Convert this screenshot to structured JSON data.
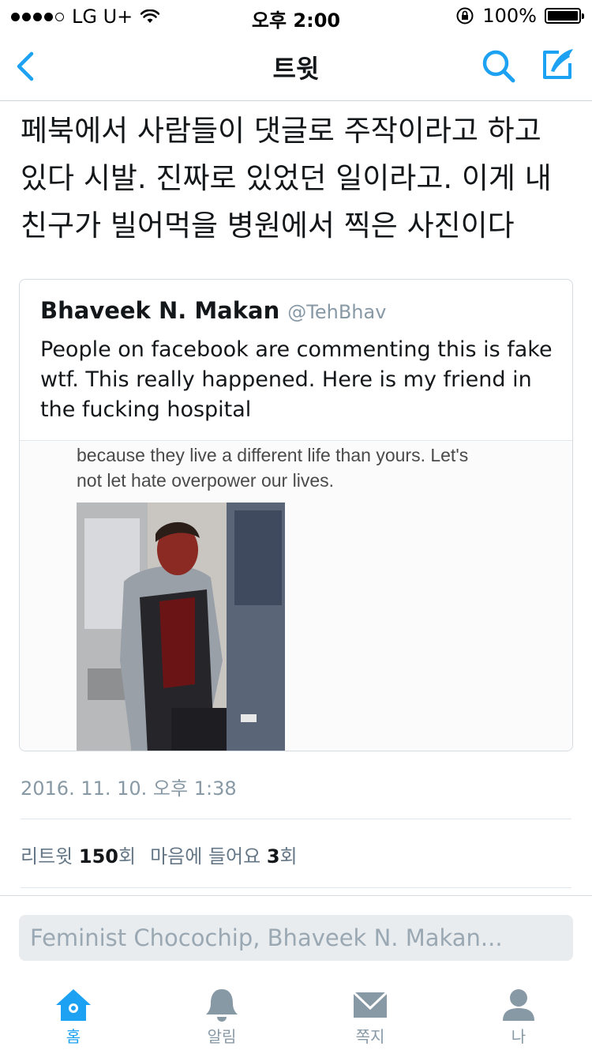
{
  "status_bar": {
    "carrier": "LG U+",
    "time": "오후 2:00",
    "battery": "100%"
  },
  "nav": {
    "title": "트윗"
  },
  "tweet": {
    "text": "페북에서 사람들이 댓글로 주작이라고 하고 있다 시발. 진짜로 있었던 일이라고. 이게 내 친구가 빌어먹을 병원에서 찍은 사진이다",
    "date": "2016. 11. 10. 오후 1:38",
    "stats": {
      "retweet_label": "리트윗",
      "retweet_count": "150",
      "retweet_unit": "회",
      "likes_label": "마음에 들어요",
      "likes_count": "3",
      "likes_unit": "회"
    }
  },
  "quoted_tweet": {
    "name": "Bhaveek N. Makan",
    "handle": "@TehBhav",
    "text": "People on facebook are commenting this is fake wtf. This really happened. Here is my friend in the fucking hospital",
    "media_caption_line1": "because they live a different life than yours. Let's",
    "media_caption_line2": "not let hate overpower our lives."
  },
  "reply": {
    "placeholder": "Feminist Chocochip, Bhaveek N. Makan..."
  },
  "tabs": [
    {
      "label": "홈",
      "icon": "home-icon",
      "active": true
    },
    {
      "label": "알림",
      "icon": "bell-icon",
      "active": false
    },
    {
      "label": "쪽지",
      "icon": "envelope-icon",
      "active": false
    },
    {
      "label": "나",
      "icon": "person-icon",
      "active": false
    }
  ],
  "colors": {
    "accent": "#1da1f2",
    "text": "#14171a",
    "muted": "#8899a6"
  }
}
